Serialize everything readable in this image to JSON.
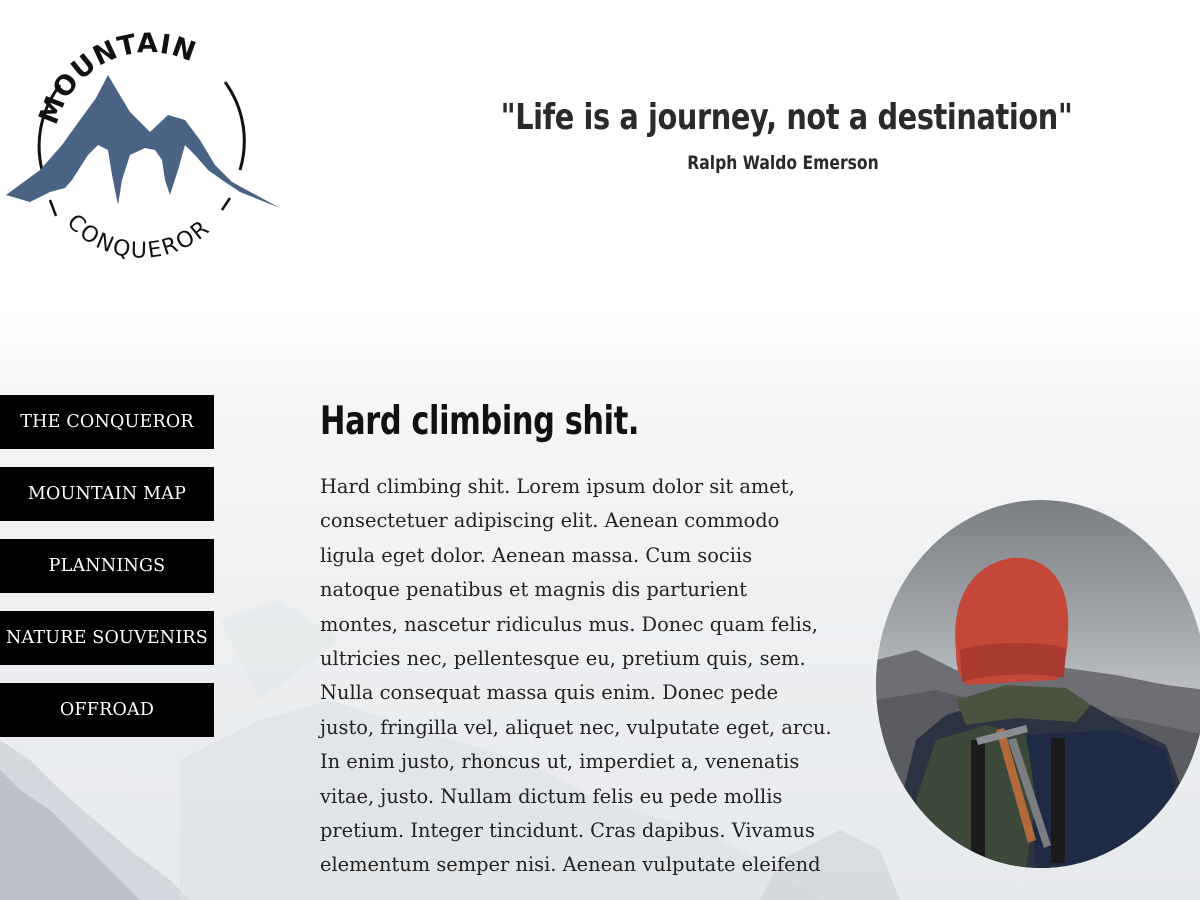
{
  "logo": {
    "top_text": "MOUNTAIN",
    "bottom_text": "CONQUEROR",
    "mountain_color": "#4a6384"
  },
  "quote": {
    "text": "\"Life is a journey, not a destination\"",
    "author": "Ralph Waldo Emerson"
  },
  "nav": {
    "items": [
      {
        "label": "THE CONQUEROR"
      },
      {
        "label": "MOUNTAIN MAP"
      },
      {
        "label": "PLANNINGS"
      },
      {
        "label": "NATURE SOUVENIRS"
      },
      {
        "label": "OFFROAD"
      }
    ]
  },
  "main": {
    "heading": "Hard climbing shit.",
    "body": "Hard climbing shit. Lorem ipsum dolor sit amet,\nconsectetuer adipiscing elit. Aenean commodo\nligula eget dolor. Aenean massa. Cum sociis\nnatoque penatibus et magnis dis parturient\nmontes, nascetur ridiculus mus. Donec quam felis,\nultricies nec, pellentesque eu, pretium quis, sem.\nNulla consequat massa quis enim. Donec pede\njusto, fringilla vel, aliquet nec, vulputate eget, arcu.\nIn enim justo, rhoncus ut, imperdiet a, venenatis\nvitae, justo. Nullam dictum felis eu pede mollis\npretium. Integer tincidunt. Cras dapibus. Vivamus\nelementum semper nisi. Aenean vulputate eleifend"
  },
  "photo": {
    "subject": "hiker-with-red-beanie"
  },
  "colors": {
    "nav_background": "#000000",
    "nav_text": "#ffffff",
    "text": "#222222",
    "logo_blue": "#4a6384",
    "beanie_red": "#c4473a"
  }
}
